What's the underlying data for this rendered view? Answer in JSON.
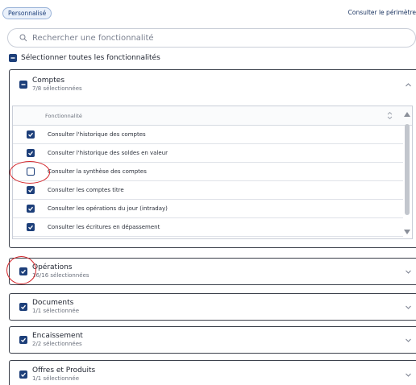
{
  "profile_chip": "Personnalisé",
  "perimeter_link": "Consulter le périmètre",
  "search": {
    "placeholder": "Rechercher une fonctionnalité"
  },
  "select_all_label": "Sélectionner toutes les fonctionnalités",
  "sections": [
    {
      "title": "Comptes",
      "subtitle": "7/8 sélectionnées",
      "expanded": true
    },
    {
      "title": "Opérations",
      "subtitle": "16/16 sélectionnées",
      "expanded": false
    },
    {
      "title": "Documents",
      "subtitle": "1/1 sélectionnée",
      "expanded": false
    },
    {
      "title": "Encaissement",
      "subtitle": "2/2 sélectionnées",
      "expanded": false
    },
    {
      "title": "Offres et Produits",
      "subtitle": "1/1 sélectionnée",
      "expanded": false
    }
  ],
  "table": {
    "header": "Fonctionnalité",
    "rows": [
      {
        "label": "Consulter l'historique des comptes",
        "checked": true
      },
      {
        "label": "Consulter l'historique des soldes en valeur",
        "checked": true
      },
      {
        "label": "Consulter la synthèse des comptes",
        "checked": false
      },
      {
        "label": "Consulter les comptes titre",
        "checked": true
      },
      {
        "label": "Consulter les opérations du jour (intraday)",
        "checked": true
      },
      {
        "label": "Consulter les écritures en dépassement",
        "checked": true
      }
    ]
  },
  "colors": {
    "accent": "#1d3f7a",
    "annotation": "#d4262b",
    "border": "#3a3f4a"
  }
}
